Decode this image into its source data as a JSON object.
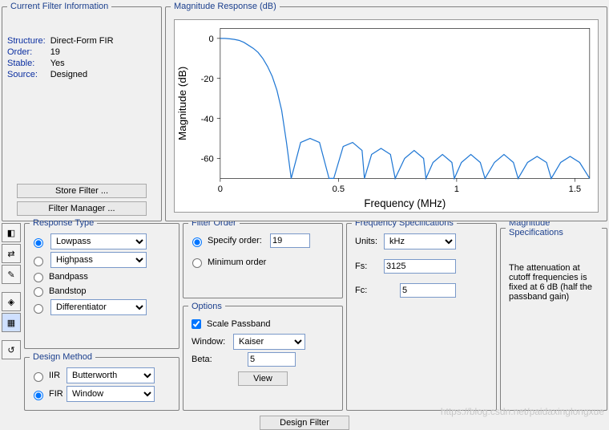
{
  "filter_info": {
    "legend": "Current Filter Information",
    "rows": [
      {
        "label": "Structure:",
        "value": "Direct-Form FIR"
      },
      {
        "label": "Order:",
        "value": "19"
      },
      {
        "label": "Stable:",
        "value": "Yes"
      },
      {
        "label": "Source:",
        "value": "Designed"
      }
    ],
    "store_btn": "Store Filter ...",
    "manager_btn": "Filter Manager ..."
  },
  "mag_response": {
    "legend": "Magnitude Response (dB)",
    "xlabel": "Frequency (MHz)",
    "ylabel": "Magnitude (dB)"
  },
  "response_type": {
    "legend": "Response Type",
    "lowpass": "Lowpass",
    "highpass": "Highpass",
    "bandpass": "Bandpass",
    "bandstop": "Bandstop",
    "diff": "Differentiator"
  },
  "design_method": {
    "legend": "Design Method",
    "iir": "IIR",
    "iir_sel": "Butterworth",
    "fir": "FIR",
    "fir_sel": "Window"
  },
  "filter_order": {
    "legend": "Filter Order",
    "specify": "Specify order:",
    "specify_val": "19",
    "minimum": "Minimum order"
  },
  "options": {
    "legend": "Options",
    "scale": "Scale Passband",
    "window": "Window:",
    "window_sel": "Kaiser",
    "beta": "Beta:",
    "beta_val": "5",
    "view": "View"
  },
  "freq_spec": {
    "legend": "Frequency Specifications",
    "units": "Units:",
    "units_sel": "kHz",
    "fs": "Fs:",
    "fs_val": "3125",
    "fc": "Fc:",
    "fc_val": "5"
  },
  "mag_spec": {
    "legend": "Magnitude Specifications",
    "text": "The attenuation at cutoff frequencies is fixed at 6 dB (half the passband gain)"
  },
  "design_btn": "Design Filter",
  "watermark": "https://blog.csdn.net/paidaxinglongxue",
  "chart_data": {
    "type": "line",
    "title": "Magnitude Response (dB)",
    "xlabel": "Frequency (MHz)",
    "ylabel": "Magnitude (dB)",
    "xlim": [
      0,
      1.5625
    ],
    "ylim": [
      -70,
      5
    ],
    "xticks": [
      0,
      0.5,
      1,
      1.5
    ],
    "yticks": [
      0,
      -20,
      -40,
      -60
    ],
    "series": [
      {
        "name": "Magnitude",
        "x": [
          0,
          0.02,
          0.04,
          0.06,
          0.08,
          0.1,
          0.12,
          0.14,
          0.16,
          0.18,
          0.2,
          0.22,
          0.24,
          0.26,
          0.28,
          0.3,
          0.34,
          0.38,
          0.42,
          0.46,
          0.48,
          0.52,
          0.56,
          0.6,
          0.61,
          0.64,
          0.68,
          0.72,
          0.74,
          0.78,
          0.82,
          0.86,
          0.87,
          0.9,
          0.94,
          0.98,
          0.99,
          1.02,
          1.06,
          1.1,
          1.12,
          1.16,
          1.2,
          1.24,
          1.26,
          1.3,
          1.34,
          1.38,
          1.4,
          1.44,
          1.48,
          1.52,
          1.5625
        ],
        "y": [
          0,
          0,
          -0.2,
          -0.5,
          -1,
          -2,
          -3.5,
          -5,
          -7,
          -10,
          -14,
          -19,
          -26,
          -36,
          -52,
          -70,
          -52,
          -50,
          -52,
          -70,
          -70,
          -54,
          -52,
          -56,
          -70,
          -58,
          -55,
          -58,
          -70,
          -60,
          -56,
          -60,
          -70,
          -62,
          -58,
          -62,
          -70,
          -62,
          -58,
          -62,
          -70,
          -62,
          -58,
          -62,
          -70,
          -62,
          -59,
          -62,
          -70,
          -62,
          -59,
          -62,
          -70
        ]
      }
    ]
  }
}
